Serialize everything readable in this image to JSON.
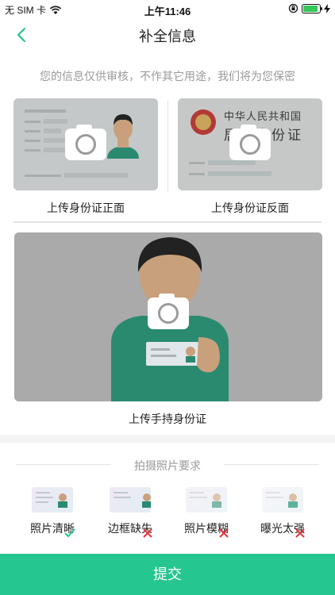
{
  "status_bar": {
    "carrier": "无 SIM 卡",
    "time": "上午11:46",
    "battery_level": 0.9,
    "battery_color": "#35c759"
  },
  "nav": {
    "title": "补全信息",
    "back_icon": "chevron-left-icon"
  },
  "notice": "您的信息仅供审核，不作其它用途，我们将为您保密",
  "id_cards": {
    "front_label": "上传身份证正面",
    "back_label": "上传身份证反面",
    "back_card_text": "中华人民共和国",
    "back_card_text2": "居民身份证"
  },
  "hold_card": {
    "label": "上传手持身份证"
  },
  "requirements": {
    "title": "拍摄照片要求",
    "items": [
      {
        "label": "照片清晰",
        "status": "ok"
      },
      {
        "label": "边框缺失",
        "status": "bad"
      },
      {
        "label": "照片模糊",
        "status": "bad"
      },
      {
        "label": "曝光太强",
        "status": "bad"
      }
    ]
  },
  "submit": {
    "label": "提交"
  },
  "colors": {
    "accent": "#26c691",
    "ok": "#26c691",
    "bad": "#e0343a"
  }
}
